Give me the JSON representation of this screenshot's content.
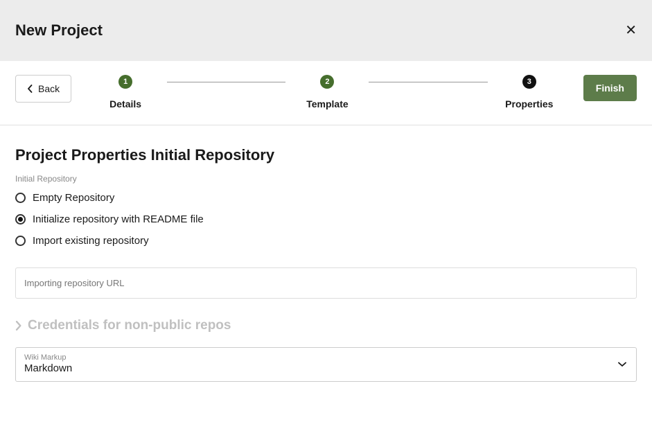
{
  "header": {
    "title": "New Project"
  },
  "nav": {
    "back_label": "Back",
    "finish_label": "Finish"
  },
  "steps": [
    {
      "num": "1",
      "label": "Details"
    },
    {
      "num": "2",
      "label": "Template"
    },
    {
      "num": "3",
      "label": "Properties"
    }
  ],
  "main": {
    "heading": "Project Properties Initial Repository",
    "section_label": "Initial Repository",
    "radios": [
      {
        "label": "Empty Repository",
        "selected": false
      },
      {
        "label": "Initialize repository with README file",
        "selected": true
      },
      {
        "label": "Import existing repository",
        "selected": false
      }
    ],
    "import_url_placeholder": "Importing repository URL",
    "credentials_heading": "Credentials for non-public repos",
    "wiki_select": {
      "label": "Wiki Markup",
      "value": "Markdown"
    }
  }
}
